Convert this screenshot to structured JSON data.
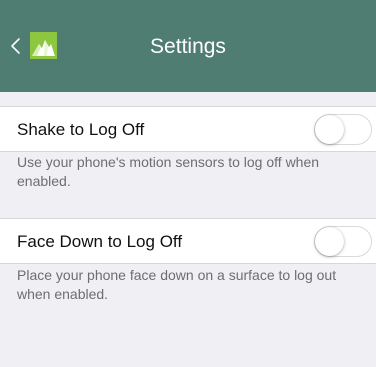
{
  "navbar": {
    "title": "Settings",
    "back_icon": "chevron-left-icon",
    "logo_icon": "app-logo-icon",
    "background_color": "#4f7d72",
    "logo_color": "#8dc63f"
  },
  "settings": [
    {
      "label": "Shake to Log Off",
      "description": "Use your phone's motion sensors to log off when enabled.",
      "enabled": false
    },
    {
      "label": "Face Down to Log Off",
      "description": "Place your phone face down on a surface to log out when enabled.",
      "enabled": false
    }
  ]
}
